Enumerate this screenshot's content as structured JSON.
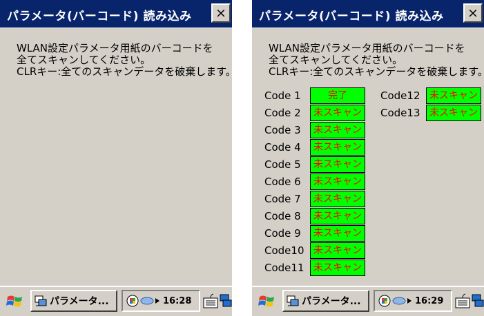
{
  "screens": [
    {
      "title": "パラメータ(バーコード) 読み込み",
      "close_label": "×",
      "instructions": [
        "WLAN設定パラメータ用紙のバーコードを",
        "全てスキャンしてください。",
        "CLRキー:全てのスキャンデータを破棄します。"
      ],
      "codes": [],
      "taskbar": {
        "task_label": "パラメータ...",
        "time": "16:28"
      }
    },
    {
      "title": "パラメータ(バーコード) 読み込み",
      "close_label": "×",
      "instructions": [
        "WLAN設定パラメータ用紙のバーコードを",
        "全てスキャンしてください。",
        "CLRキー:全てのスキャンデータを破棄します。"
      ],
      "codes": [
        {
          "label": "Code 1",
          "status": "完了"
        },
        {
          "label": "Code 2",
          "status": "未スキャン"
        },
        {
          "label": "Code 3",
          "status": "未スキャン"
        },
        {
          "label": "Code 4",
          "status": "未スキャン"
        },
        {
          "label": "Code 5",
          "status": "未スキャン"
        },
        {
          "label": "Code 6",
          "status": "未スキャン"
        },
        {
          "label": "Code 7",
          "status": "未スキャン"
        },
        {
          "label": "Code 8",
          "status": "未スキャン"
        },
        {
          "label": "Code 9",
          "status": "未スキャン"
        },
        {
          "label": "Code10",
          "status": "未スキャン"
        },
        {
          "label": "Code11",
          "status": "未スキャン"
        },
        {
          "label": "Code12",
          "status": "未スキャン"
        },
        {
          "label": "Code13",
          "status": "未スキャン"
        }
      ],
      "taskbar": {
        "task_label": "パラメータ...",
        "time": "16:29"
      }
    }
  ],
  "colors": {
    "titlebar": "#08246b",
    "status_fill": "#00ff00",
    "status_text": "#ff0000",
    "window_bg": "#d4d0c8"
  },
  "icons": [
    "windows-start-icon",
    "app-task-icon",
    "network-icon",
    "connection-icon",
    "play-arrow-icon",
    "keyboard-icon",
    "switch-window-icon"
  ]
}
